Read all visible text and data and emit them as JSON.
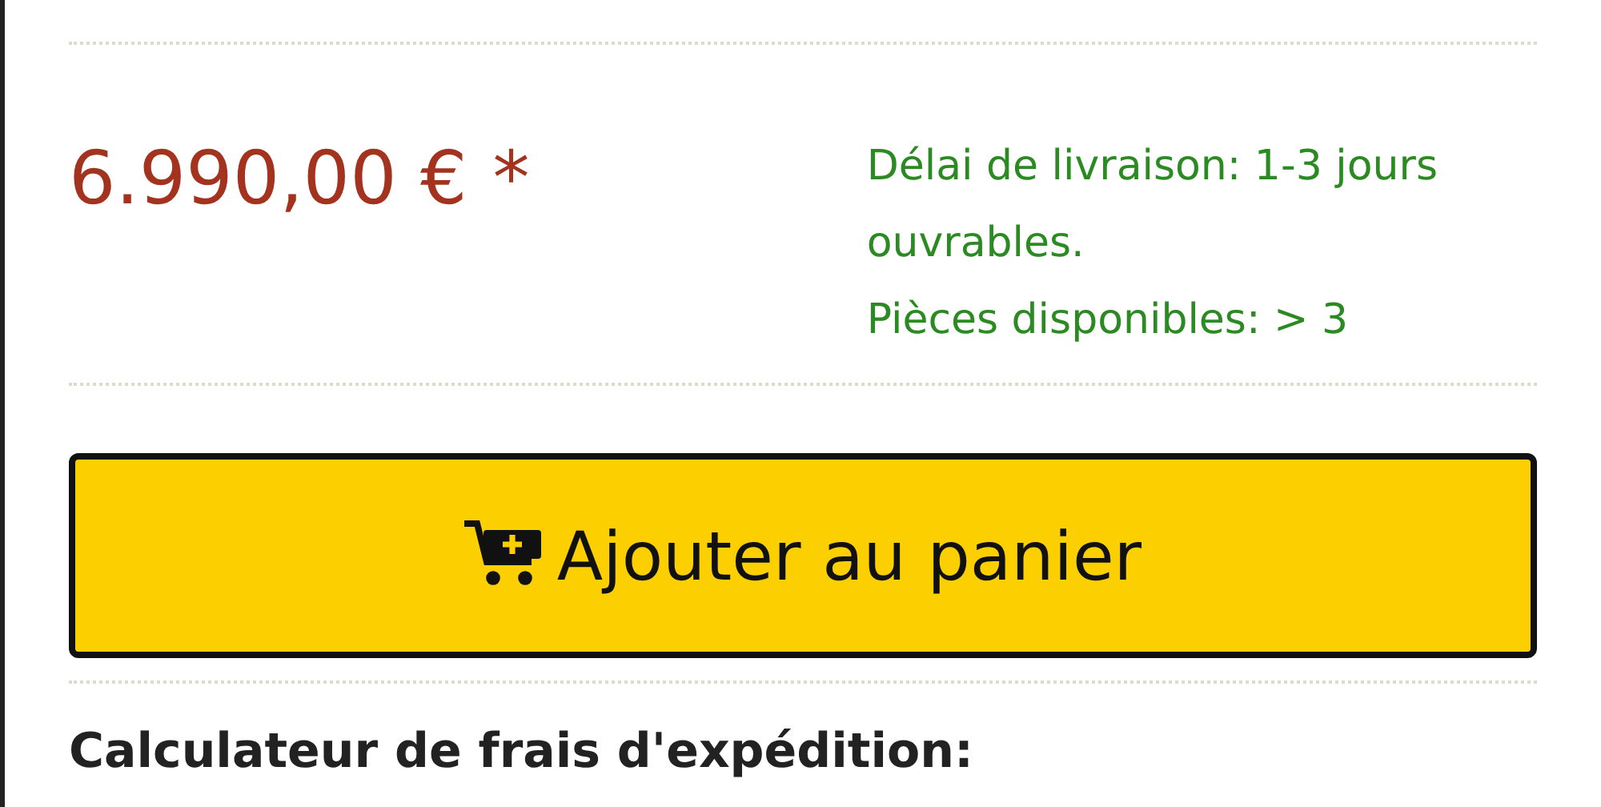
{
  "price": {
    "amount": "6.990,00 €",
    "note": "*"
  },
  "delivery": [
    "Délai de livraison: 1-3 jours ouvrables.",
    "Pièces disponibles: > 3"
  ],
  "cart_button": {
    "label": "Ajouter au panier"
  },
  "shipping_calculator": {
    "title": "Calculateur de frais d'expédition:"
  }
}
